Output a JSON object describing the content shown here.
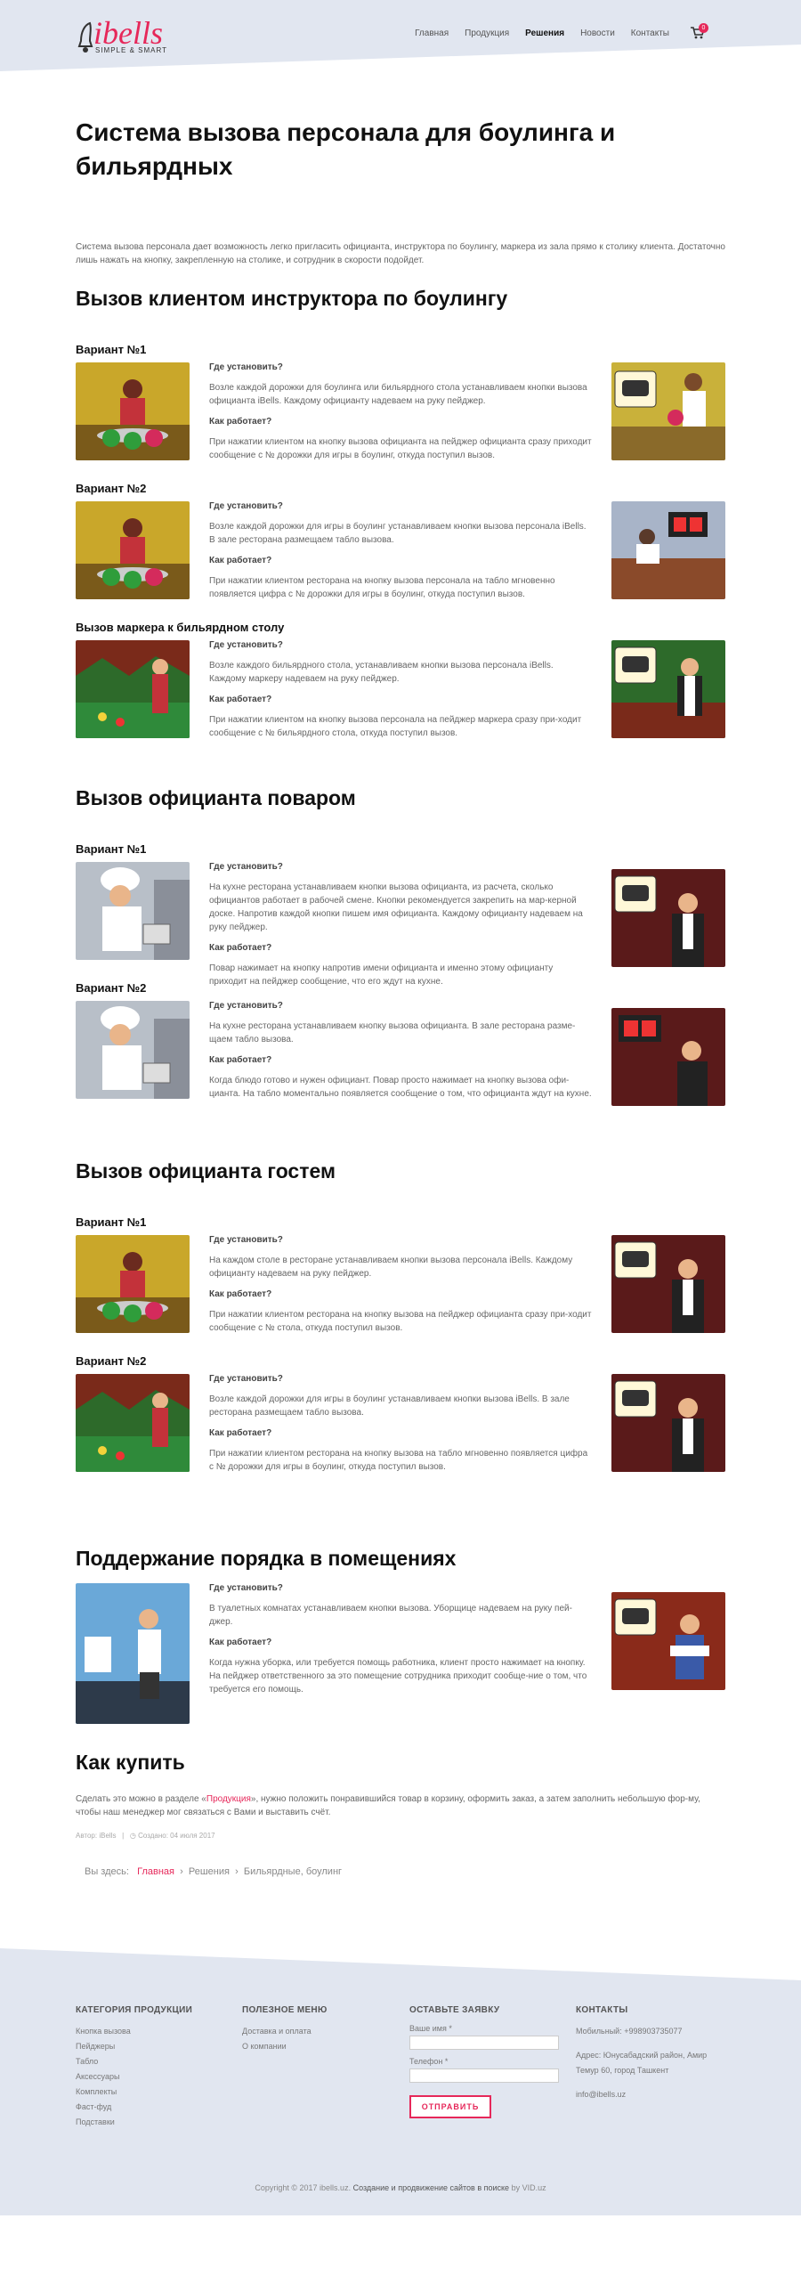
{
  "header": {
    "logo_brand": "ibells",
    "logo_tagline": "SIMPLE & SMART",
    "nav": [
      "Главная",
      "Продукция",
      "Решения",
      "Новости",
      "Контакты"
    ],
    "nav_active": "Решения",
    "cart_count": "0"
  },
  "page": {
    "title": "Система вызова персонала для боулинга и бильярдных",
    "intro": "Система вызова персонала дает возможность легко пригласить официанта, инструктора по боулингу, маркера из зала прямо к столику клиента. Достаточно лишь нажать на кнопку, закрепленную на столике, и сотрудник в скорости подойдет."
  },
  "labels": {
    "where": "Где установить?",
    "how": "Как работает?"
  },
  "sections": [
    {
      "title": "Вызов клиентом инструктора по боулингу",
      "items": [
        {
          "name": "Вариант №1",
          "where": "Возле каждой дорожки для боулинга или бильярдного стола устанавливаем кнопки вызова официанта iBells. Каждому официанту надеваем на руку пейджер.",
          "how": "При нажатии клиентом на кнопку вызова официанта на пейджер официанта сразу приходит сообщение с № дорожки для игры в боулинг, откуда поступил вызов."
        },
        {
          "name": "Вариант №2",
          "where": "Возле каждой дорожки для игры в боулинг устанавливаем кнопки вызова персонала iBells. В зале ресторана размещаем табло вызова.",
          "how": "При нажатии клиентом ресторана на кнопку вызова персонала на табло мгновенно появляется цифра с № дорожки для игры в боулинг, откуда поступил вызов."
        },
        {
          "name": "Вызов маркера к бильярдном столу",
          "where": "Возле каждого бильярдного стола, устанавливаем кнопки вызова персонала iBells. Каждому маркеру надеваем на руку пейджер.",
          "how": "При нажатии клиентом на кнопку вызова персонала на пейджер маркера сразу при-ходит сообщение с № бильярдного стола, откуда поступил вызов."
        }
      ]
    },
    {
      "title": "Вызов официанта поваром",
      "items": [
        {
          "name": "Вариант №1",
          "where": "На кухне ресторана устанавливаем кнопки вызова официанта, из расчета, сколько официантов работает в рабочей смене. Кнопки рекомендуется закрепить на мар-керной доске. Напротив каждой кнопки пишем имя официанта. Каждому официанту надеваем на руку пейджер.",
          "how": "Повар нажимает на кнопку напротив имени официанта и именно этому официанту приходит на пейджер сообщение, что его ждут на кухне."
        },
        {
          "name": "Вариант №2",
          "where": "На кухне ресторана устанавливаем кнопку вызова официанта. В зале ресторана разме-щаем табло вызова.",
          "how": "Когда блюдо готово и нужен официант. Повар просто нажимает на кнопку вызова офи-цианта. На табло моментально появляется сообщение о том, что официанта ждут на кухне."
        }
      ]
    },
    {
      "title": "Вызов официанта гостем",
      "items": [
        {
          "name": "Вариант №1",
          "where": "На каждом столе в ресторане устанавливаем кнопки вызова персонала iBells. Каждому официанту надеваем на руку пейджер.",
          "how": "При нажатии клиентом ресторана на кнопку вызова на пейджер официанта сразу при-ходит сообщение с № стола, откуда поступил вызов."
        },
        {
          "name": "Вариант №2",
          "where": "Возле каждой дорожки для игры в боулинг устанавливаем кнопки вызова iBells. В зале ресторана размещаем табло вызова.",
          "how": "При нажатии клиентом ресторана на кнопку вызова на табло мгновенно появляется цифра с № дорожки для игры в боулинг, откуда поступил вызов."
        }
      ]
    },
    {
      "title": "Поддержание порядка в помещениях",
      "items": [
        {
          "name": "",
          "where": "В туалетных комнатах устанавливаем кнопки вызова. Уборщице надеваем на руку пей-джер.",
          "how": "Когда нужна уборка, или требуется помощь работника, клиент просто нажимает на кнопку. На пейджер ответственного за это помещение сотрудника приходит сообще-ние о том, что требуется его помощь."
        }
      ]
    }
  ],
  "buy": {
    "title": "Как купить",
    "text_before": "Сделать это можно в разделе «",
    "link": "Продукция",
    "text_after": "», нужно положить понравившийся товар в корзину, оформить заказ, а затем заполнить небольшую фор-му, чтобы наш менеджер мог связаться с Вами и выставить счёт."
  },
  "meta": {
    "author": "Автор: iBells",
    "created": "Создано: 04 июля 2017"
  },
  "breadcrumb": {
    "label": "Вы здесь:",
    "items": [
      "Главная",
      "Решения",
      "Бильярдные, боулинг"
    ]
  },
  "footer": {
    "cat_title": "КАТЕГОРИЯ ПРОДУКЦИИ",
    "categories": [
      "Кнопка вызова",
      "Пейджеры",
      "Табло",
      "Аксессуары",
      "Комплекты",
      "Фаст-фуд",
      "Подставки"
    ],
    "menu_title": "ПОЛЕЗНОЕ МЕНЮ",
    "menu": [
      "Доставка и оплата",
      "О компании"
    ],
    "form_title": "ОСТАВЬТЕ ЗАЯВКУ",
    "name_label": "Ваше имя *",
    "phone_label": "Телефон *",
    "submit": "ОТПРАВИТЬ",
    "contacts_title": "КОНТАКТЫ",
    "phone": "Мобильный: +998903735077",
    "address": "Адрес: Юнусабадский район, Амир Темур 60, город Ташкент",
    "email": "info@ibells.uz",
    "copyright_1": "Copyright © 2017 ibells.uz.",
    "copyright_2": "Создание и продвижение сайтов в поиске",
    "copyright_3": "by VID.uz"
  },
  "colors": {
    "accent": "#e6285a",
    "header_bg": "#e1e6f0"
  }
}
